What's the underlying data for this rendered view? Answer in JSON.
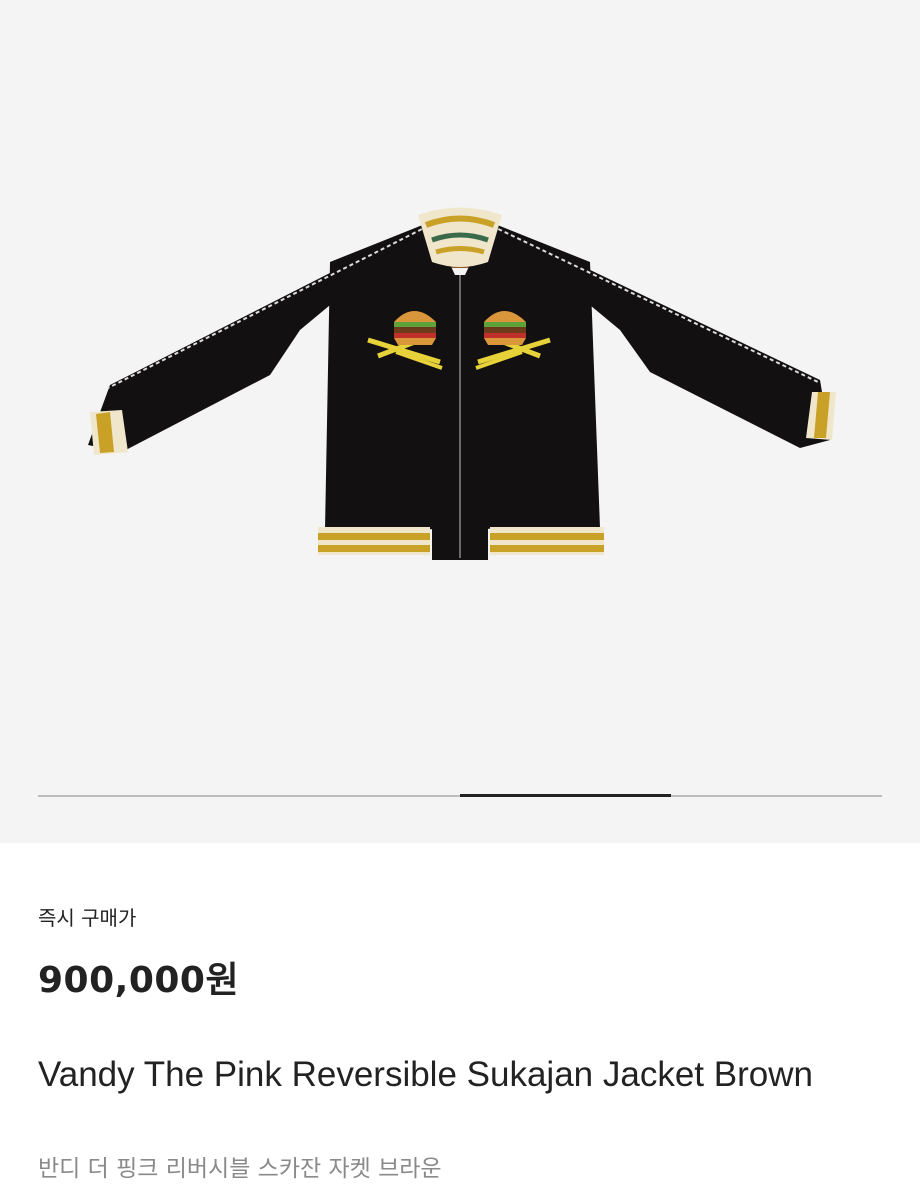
{
  "gallery": {
    "image_alt": "Black sukajan jacket with embroidered hamburger and fries",
    "progress_fraction": 0.25,
    "progress_index": 3,
    "progress_total": 4
  },
  "product": {
    "price_label": "즉시 구매가",
    "price": "900,000원",
    "title": "Vandy The Pink Reversible Sukajan Jacket Brown",
    "subtitle": "반디 더 핑크 리버시블 스카잔 자켓 브라운"
  },
  "colors": {
    "jacket_body": "#121010",
    "rib_mustard": "#c9a126",
    "rib_cream": "#efe6cc",
    "background": "#f4f4f4"
  }
}
